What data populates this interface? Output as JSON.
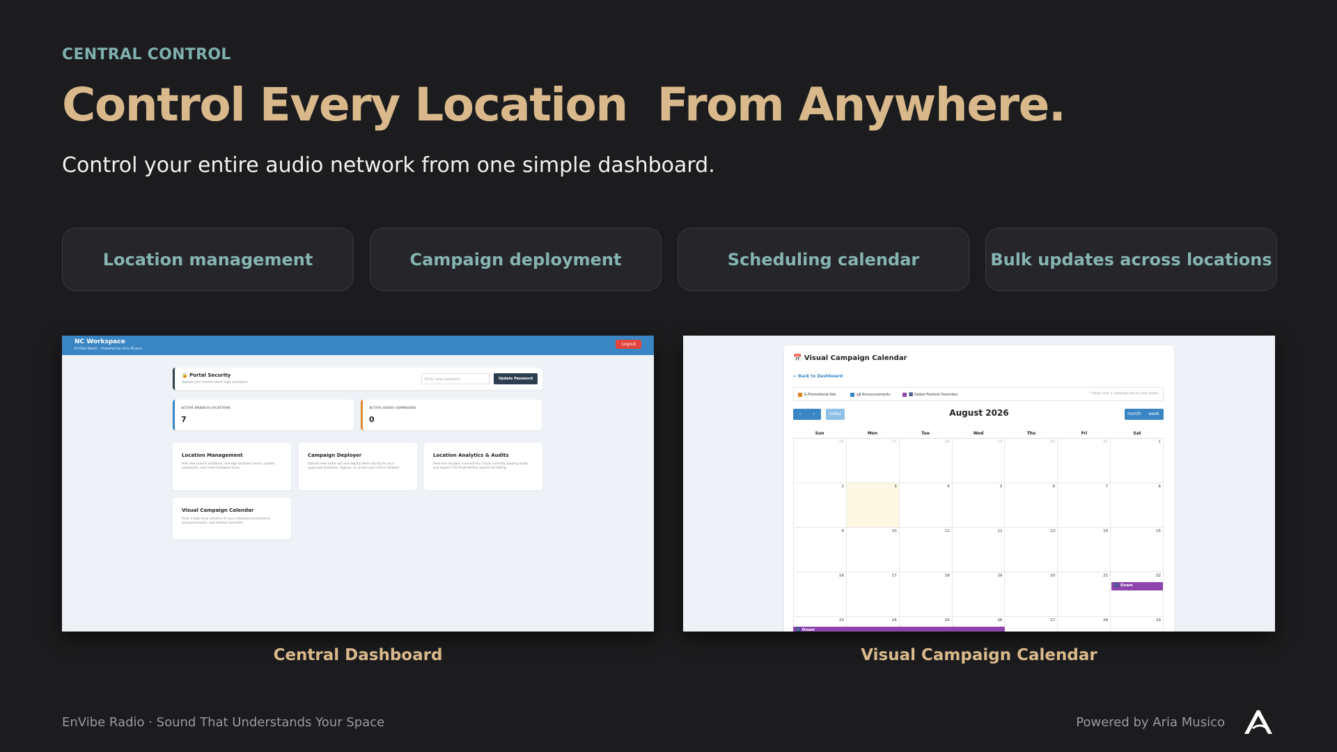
{
  "header": {
    "eyebrow": "CENTRAL CONTROL",
    "title": "Control Every Location  From Anywhere.",
    "subtitle": "Control your entire audio network from one simple dashboard."
  },
  "features": [
    {
      "label": "Location management"
    },
    {
      "label": "Campaign deployment"
    },
    {
      "label": "Scheduling calendar"
    },
    {
      "label": "Bulk updates across locations"
    }
  ],
  "dashboard": {
    "caption": "Central Dashboard",
    "brand": "NC Workspace",
    "brand_sub": "EnVibe Radio - Powered by Aria Musico",
    "logout": "Logout",
    "security_title": "🔒 Portal Security",
    "security_sub": "Update your master client login password.",
    "password_placeholder": "Enter new password",
    "update_button": "Update Password",
    "stats": [
      {
        "label": "ACTIVE BRANCH LOCATIONS",
        "value": "7"
      },
      {
        "label": "ACTIVE AUDIO CAMPAIGNS",
        "value": "0"
      }
    ],
    "modules": [
      {
        "title": "Location Management",
        "desc": "Add new branch locations, manage business hours, update passwords, and reset hardware locks."
      },
      {
        "title": "Campaign Deployer",
        "desc": "Upload new audio ads and deploy them strictly to your approved locations, regions, or across your entire network."
      },
      {
        "title": "Location Analytics & Audits",
        "desc": "View live location connectivity, track currently playing audio, and export CSV Proof-of-Play reports for billing."
      },
      {
        "title": "Visual Campaign Calendar",
        "desc": "View a high-level timeline of your scheduled promotions, announcements, and festival overrides."
      }
    ]
  },
  "calendar": {
    "caption": "Visual Campaign Calendar",
    "title": "📅 Visual Campaign Calendar",
    "back": "← Back to Dashboard",
    "legend": [
      {
        "label": "$ Promotional Ads",
        "color": "#e67e22"
      },
      {
        "label": "📢 Announcements",
        "color": "#3a86c4"
      },
      {
        "label": "🎆 Global Festival Overrides",
        "color": "#8e44ad"
      }
    ],
    "hint": "* Hover over a campaign bar to view details",
    "prev": "‹",
    "next": "›",
    "today": "today",
    "month_btn": "month",
    "week_btn": "week",
    "month": "August 2026",
    "weekdays": [
      "Sun",
      "Mon",
      "Tue",
      "Wed",
      "Thu",
      "Fri",
      "Sat"
    ],
    "weeks": [
      [
        "26",
        "27",
        "28",
        "29",
        "30",
        "31",
        "1"
      ],
      [
        "2",
        "3",
        "4",
        "5",
        "6",
        "7",
        "8"
      ],
      [
        "9",
        "10",
        "11",
        "12",
        "13",
        "14",
        "15"
      ],
      [
        "16",
        "17",
        "18",
        "19",
        "20",
        "21",
        "22"
      ],
      [
        "23",
        "24",
        "25",
        "26",
        "27",
        "28",
        "29"
      ]
    ],
    "event_label": "🎆 Onam"
  },
  "footer": {
    "left": "EnVibe Radio  ·  Sound That Understands Your Space",
    "right": "Powered by Aria Musico"
  }
}
